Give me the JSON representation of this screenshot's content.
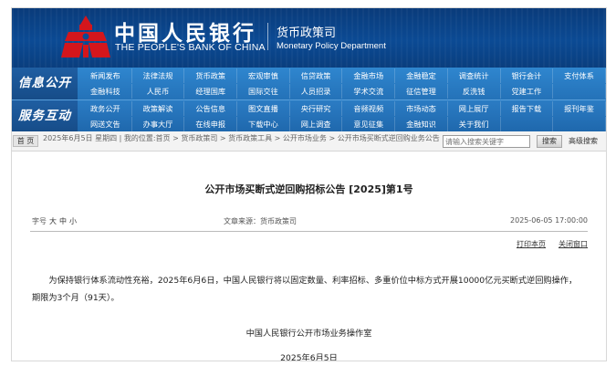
{
  "header": {
    "cn_title": "中国人民银行",
    "en_title": "THE PEOPLE'S BANK OF CHINA",
    "dept_cn": "货币政策司",
    "dept_en": "Monetary Policy Department"
  },
  "nav": {
    "group1": {
      "label": "信息公开",
      "row1": [
        "新闻发布",
        "法律法规",
        "货币政策",
        "宏观审慎",
        "信贷政策",
        "金融市场",
        "金融稳定",
        "调查统计",
        "银行会计",
        "支付体系"
      ],
      "row2": [
        "金融科技",
        "人民币",
        "经理国库",
        "国际交往",
        "人员招录",
        "学术交流",
        "征信管理",
        "反洗钱",
        "党建工作",
        ""
      ]
    },
    "group2": {
      "label": "服务互动",
      "row1": [
        "政务公开",
        "政策解读",
        "公告信息",
        "图文直播",
        "央行研究",
        "音频视频",
        "市场动态",
        "网上展厅",
        "报告下载",
        "报刊年鉴"
      ],
      "row2": [
        "网送文告",
        "办事大厅",
        "在线申报",
        "下载中心",
        "网上调查",
        "意见征集",
        "金融知识",
        "关于我们",
        "",
        ""
      ]
    }
  },
  "locbar": {
    "home": "首 页",
    "location": "2025年6月5日 星期四 | 我的位置:首页 > 货币政策司 > 货币政策工具 > 公开市场业务 > 公开市场买断式逆回购业务公告",
    "search_placeholder": "请输入搜索关键字",
    "search_button": "搜索",
    "advanced_search": "高级搜索"
  },
  "article": {
    "title": "公开市场买断式逆回购招标公告 [2025]第1号",
    "font_size_label": "字号",
    "font_sizes": [
      "大",
      "中",
      "小"
    ],
    "source": "文章来源：货币政策司",
    "date": "2025-06-05 17:00:00",
    "print": "打印本页",
    "close": "关闭窗口",
    "body": "为保持银行体系流动性充裕，2025年6月6日，中国人民银行将以固定数量、利率招标、多重价位中标方式开展10000亿元买断式逆回购操作，期限为3个月（91天）。",
    "signature": "中国人民银行公开市场业务操作室",
    "sign_date": "2025年6月5日"
  },
  "colors": {
    "banner": "#0b4a94",
    "nav": "#2b7cc1",
    "logo_red": "#d4161c"
  }
}
